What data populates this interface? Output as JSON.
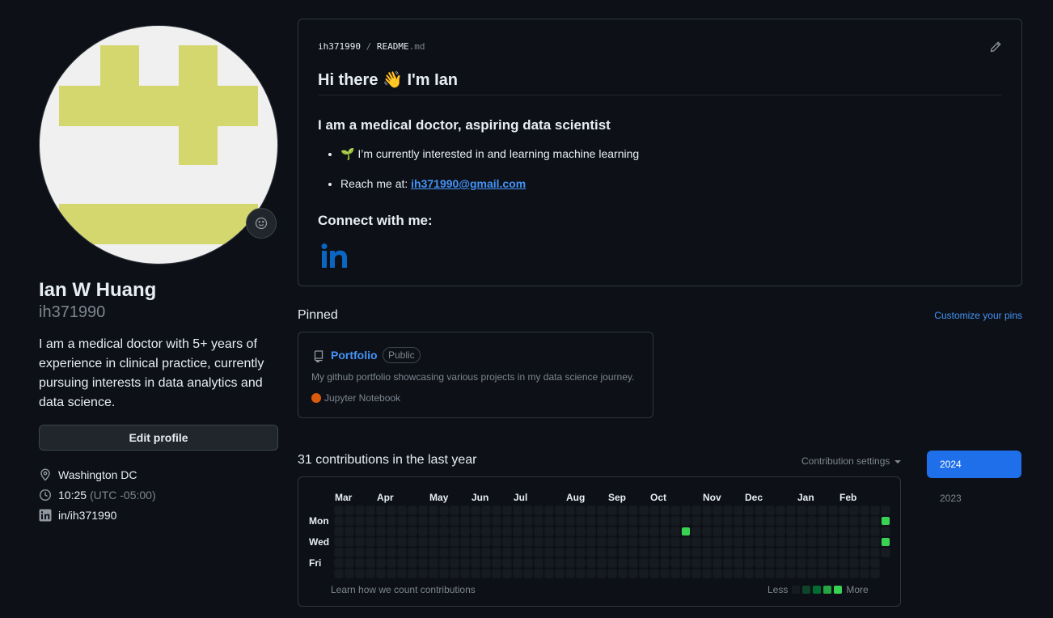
{
  "profile": {
    "name": "Ian W Huang",
    "login": "ih371990",
    "bio": "I am a medical doctor with 5+ years of experience in clinical practice, currently pursuing interests in data analytics and data science.",
    "edit_label": "Edit profile",
    "location": "Washington DC",
    "time": "10:25",
    "timezone": "(UTC -05:00)",
    "linkedin": "in/ih371990",
    "avatar_colors": {
      "bg": "#f0f0f0",
      "fg": "#d4d66e"
    }
  },
  "readme": {
    "owner": "ih371990",
    "separator": "/",
    "file_base": "README",
    "file_ext": ".md",
    "heading": "Hi there 👋 I'm Ian",
    "subheading": "I am a medical doctor, aspiring data scientist",
    "bullet1": "🌱 I’m currently interested in and learning machine learning",
    "bullet2_prefix": "Reach me at: ",
    "bullet2_email": "ih371990@gmail.com",
    "connect_heading": "Connect with me:",
    "linkedin_logo": "in",
    "edit_icon": "pencil-icon"
  },
  "pinned": {
    "title": "Pinned",
    "customize_label": "Customize your pins",
    "repo": {
      "name": "Portfolio",
      "visibility": "Public",
      "description": "My github portfolio showcasing various projects in my data science journey.",
      "language": "Jupyter Notebook",
      "language_color": "#DA5B0B"
    }
  },
  "contributions": {
    "title": "31 contributions in the last year",
    "settings_label": "Contribution settings",
    "months": [
      "Mar",
      "Apr",
      "May",
      "Jun",
      "Jul",
      "Aug",
      "Sep",
      "Oct",
      "Nov",
      "Dec",
      "Jan",
      "Feb"
    ],
    "days": [
      "Mon",
      "Wed",
      "Fri"
    ],
    "learn_label": "Learn how we count contributions",
    "less_label": "Less",
    "more_label": "More",
    "levels": [
      "#161b22",
      "#0e4429",
      "#006d32",
      "#26a641",
      "#39d353"
    ],
    "active_cells": [
      {
        "week": 33,
        "day": 2,
        "level": 4
      },
      {
        "week": 52,
        "day": 1,
        "level": 4
      },
      {
        "week": 52,
        "day": 3,
        "level": 4
      }
    ],
    "years": [
      "2024",
      "2023"
    ],
    "selected_year": "2024"
  }
}
